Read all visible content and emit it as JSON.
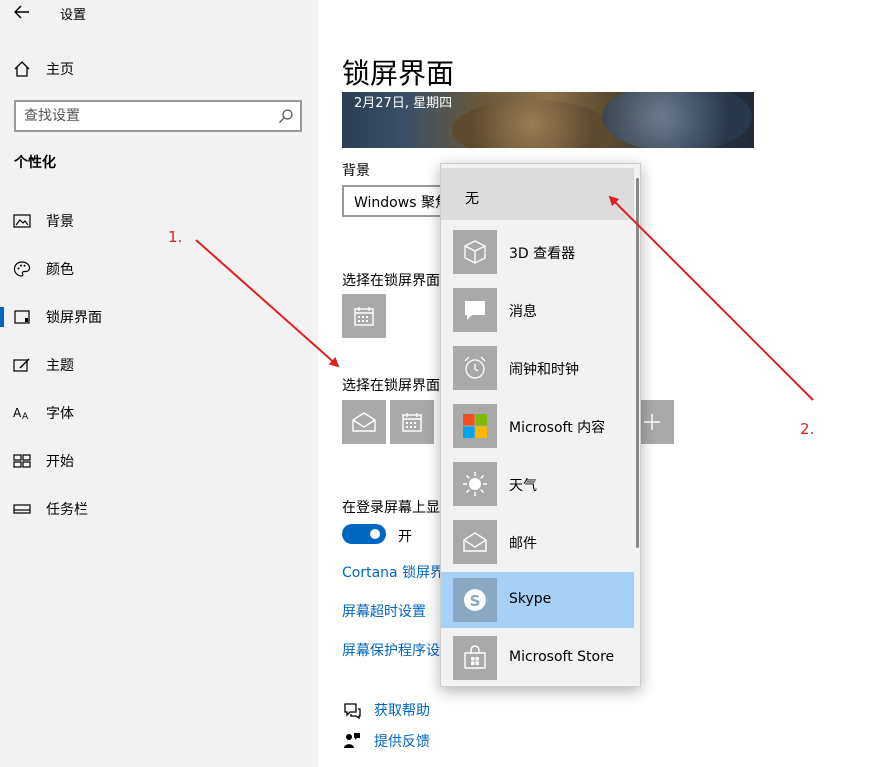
{
  "app": {
    "title": "设置"
  },
  "nav": {
    "home": "主页",
    "search_placeholder": "查找设置",
    "section": "个性化",
    "items": [
      {
        "label": "背景",
        "icon": "picture-icon"
      },
      {
        "label": "颜色",
        "icon": "palette-icon"
      },
      {
        "label": "锁屏界面",
        "icon": "lockscreen-icon",
        "selected": true
      },
      {
        "label": "主题",
        "icon": "theme-icon"
      },
      {
        "label": "字体",
        "icon": "font-icon"
      },
      {
        "label": "开始",
        "icon": "start-icon"
      },
      {
        "label": "任务栏",
        "icon": "taskbar-icon"
      }
    ]
  },
  "main": {
    "title": "锁屏界面",
    "preview_date": "2月27日, 星期四",
    "background_label": "背景",
    "background_value": "Windows 聚焦",
    "detail_label": "选择在锁屏界面上显示详细状态的应用",
    "quick_label": "选择在锁屏界面上显示快速状态的应用",
    "login_label": "在登录屏幕上显示锁屏界面背景图片",
    "toggle_state": "开",
    "toggle_on": true,
    "links": [
      "Cortana 锁屏界面设置",
      "屏幕超时设置",
      "屏幕保护程序设置"
    ],
    "help": [
      "获取帮助",
      "提供反馈"
    ],
    "accent_color": "#0067c0"
  },
  "dropdown": {
    "none_label": "无",
    "items": [
      {
        "label": "3D 查看器",
        "icon": "cube-icon"
      },
      {
        "label": "消息",
        "icon": "message-icon"
      },
      {
        "label": "闹钟和时钟",
        "icon": "alarm-clock-icon"
      },
      {
        "label": "Microsoft 内容",
        "icon": "microsoft-logo-icon"
      },
      {
        "label": "天气",
        "icon": "sun-icon"
      },
      {
        "label": "邮件",
        "icon": "mail-icon"
      },
      {
        "label": "Skype",
        "icon": "skype-icon",
        "selected": true
      },
      {
        "label": "Microsoft Store",
        "icon": "store-icon"
      }
    ],
    "selected_color": "#a6d0f6"
  },
  "annotations": {
    "label_1": "1.",
    "label_2": "2.",
    "color": "#e02020"
  }
}
